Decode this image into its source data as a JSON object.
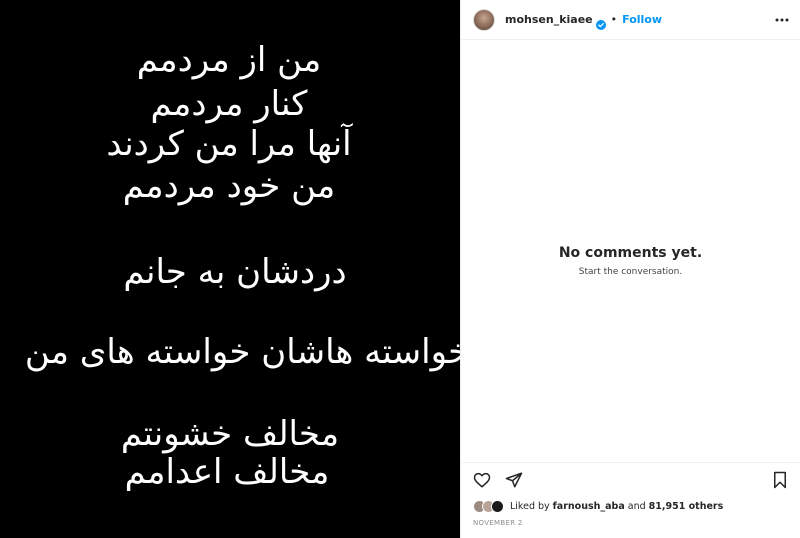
{
  "post": {
    "lines": [
      "من از مردمم",
      "کنار مردمم",
      "آنها مرا من کردند",
      "من خود مردمم",
      "دردشان به جانم",
      "خواسته هاشان خواسته های من",
      "مخالف خشونتم",
      "مخالف اعدامم"
    ]
  },
  "header": {
    "username": "mohsen_kiaee",
    "separator": "•",
    "follow_label": "Follow"
  },
  "comments": {
    "empty_title": "No comments yet.",
    "empty_subtitle": "Start the conversation."
  },
  "likes": {
    "prefix": "Liked by ",
    "user": "farnoush_aba",
    "middle": " and ",
    "count": "81,951 others"
  },
  "date": "NOVEMBER 2",
  "colors": {
    "follow": "#0095f6",
    "verified": "#0095f6",
    "media_bg": "#000000"
  },
  "icons": [
    "verified-icon",
    "more-options-icon",
    "heart-icon",
    "share-icon",
    "save-icon"
  ]
}
